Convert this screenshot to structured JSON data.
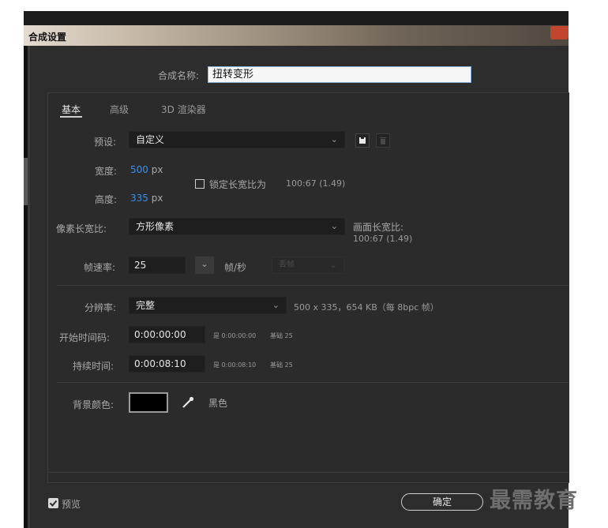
{
  "window": {
    "title": "合成设置"
  },
  "name_field": {
    "label": "合成名称:",
    "value": "扭转变形"
  },
  "tabs": [
    {
      "label": "基本"
    },
    {
      "label": "高级"
    },
    {
      "label": "3D 渲染器"
    }
  ],
  "preset": {
    "label": "预设:",
    "value": "自定义"
  },
  "width": {
    "label": "宽度:",
    "value": "500",
    "unit": "px"
  },
  "height": {
    "label": "高度:",
    "value": "335",
    "unit": "px"
  },
  "lock_aspect": {
    "label": "锁定长宽比为",
    "ratio": "100:67 (1.49)",
    "checked": false
  },
  "pixel_aspect": {
    "label": "像素长宽比:",
    "value": "方形像素"
  },
  "frame_aspect": {
    "label": "画面长宽比:",
    "value": "100:67 (1.49)"
  },
  "frame_rate": {
    "label": "帧速率:",
    "value": "25",
    "unit": "帧/秒",
    "mode": "丢帧"
  },
  "resolution": {
    "label": "分辨率:",
    "value": "完整",
    "info": "500 x 335，654 KB（每 8bpc 帧）"
  },
  "start_timecode": {
    "label": "开始时间码:",
    "value": "0:00:00:00",
    "note": "是 0:00:00:00",
    "base": "基础 25"
  },
  "duration": {
    "label": "持续时间:",
    "value": "0:00:08:10",
    "note": "是 0:00:08:10",
    "base": "基础 25"
  },
  "background": {
    "label": "背景颜色:",
    "color": "#000000",
    "color_name": "黑色"
  },
  "preview": {
    "label": "预览",
    "checked": true
  },
  "buttons": {
    "ok": "确定"
  },
  "watermark": "最需教育"
}
